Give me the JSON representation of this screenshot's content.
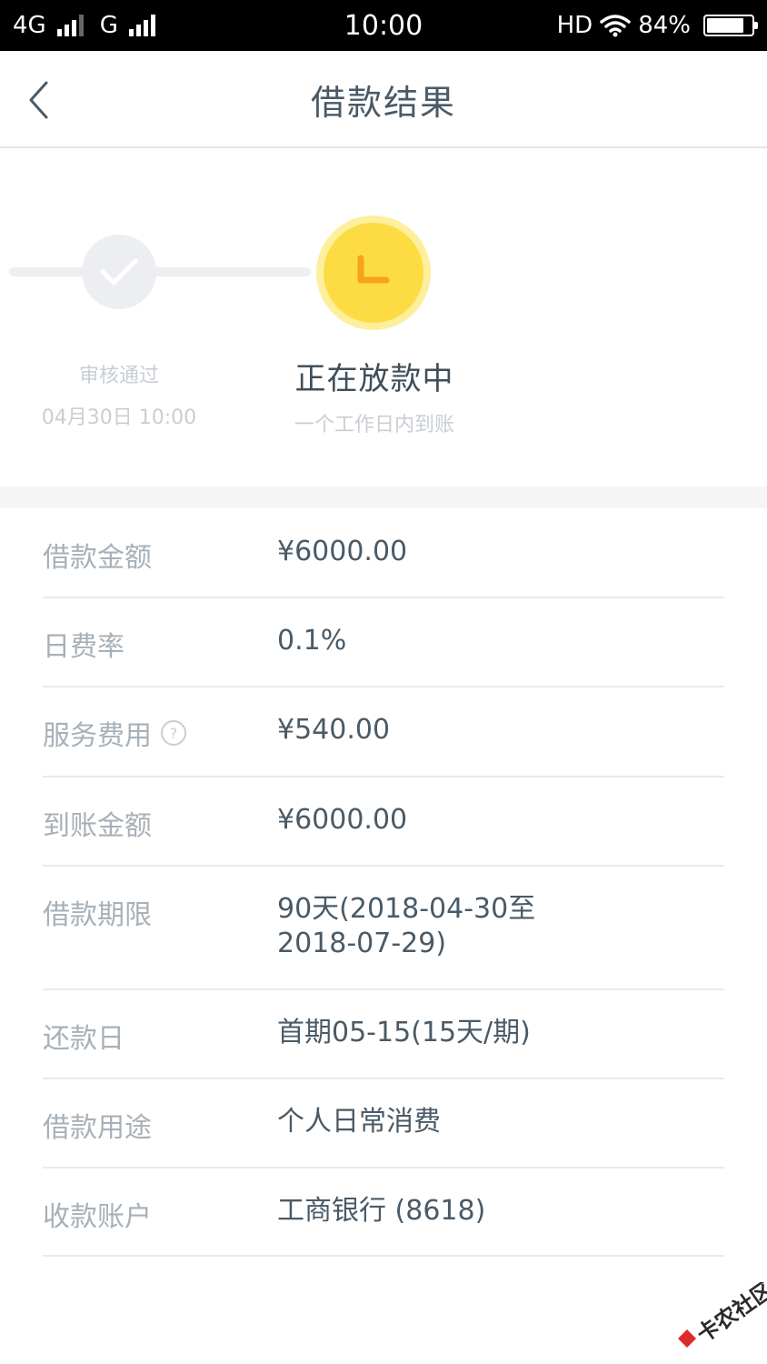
{
  "status_bar": {
    "network1": "4G",
    "network2": "G",
    "time": "10:00",
    "hd": "HD",
    "battery": "84%",
    "battery_level": 0.84
  },
  "header": {
    "title": "借款结果"
  },
  "progress": {
    "step_done": {
      "label": "审核通过",
      "time": "04月30日 10:00"
    },
    "step_current": {
      "label": "正在放款中",
      "subtitle": "一个工作日内到账"
    }
  },
  "details": [
    {
      "label": "借款金额",
      "value": "¥6000.00"
    },
    {
      "label": "日费率",
      "value": "0.1%"
    },
    {
      "label": "服务费用",
      "value": "¥540.00",
      "help": "?"
    },
    {
      "label": "到账金额",
      "value": "¥6000.00"
    },
    {
      "label": "借款期限",
      "value": "90天(2018-04-30至",
      "value2": "2018-07-29)"
    },
    {
      "label": "还款日",
      "value": "首期05-15(15天/期)"
    },
    {
      "label": "借款用途",
      "value": "个人日常消费"
    },
    {
      "label": "收款账户",
      "value": "工商银行 (8618)"
    }
  ],
  "watermark": {
    "text": "卡农社区"
  },
  "colors": {
    "accent_yellow": "#fddc43",
    "clock_orange": "#f7a21b",
    "text_dark": "#4a5a66",
    "text_light": "#a7b0b8"
  }
}
